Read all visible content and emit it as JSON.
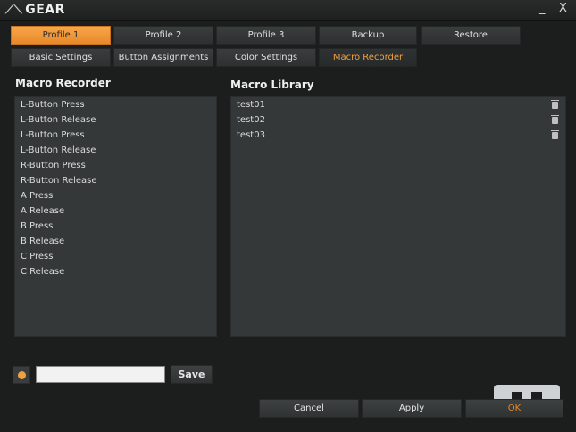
{
  "app": {
    "title": "GEAR",
    "minimize": "_",
    "close": "X"
  },
  "profile_tabs": [
    "Profile 1",
    "Profile 2",
    "Profile 3",
    "Backup",
    "Restore"
  ],
  "settings_tabs": [
    "Basic Settings",
    "Button Assignments",
    "Color Settings",
    "Macro Recorder"
  ],
  "recorder": {
    "title": "Macro Recorder",
    "items": [
      "L-Button Press",
      "L-Button Release",
      "L-Button Press",
      "L-Button Release",
      "R-Button Press",
      "R-Button Release",
      "A Press",
      "A Release",
      "B Press",
      "B Release",
      "C Press",
      "C Release"
    ]
  },
  "library": {
    "title": "Macro Library",
    "items": [
      "test01",
      "test02",
      "test03"
    ]
  },
  "macro_name": {
    "value": "",
    "placeholder": ""
  },
  "buttons": {
    "save": "Save",
    "cancel": "Cancel",
    "apply": "Apply",
    "ok": "OK"
  },
  "colors": {
    "accent": "#f0a040",
    "panel": "#343838",
    "background": "#1c1e1e"
  },
  "icons": {
    "record": "record-icon",
    "trash": "trash-icon"
  }
}
